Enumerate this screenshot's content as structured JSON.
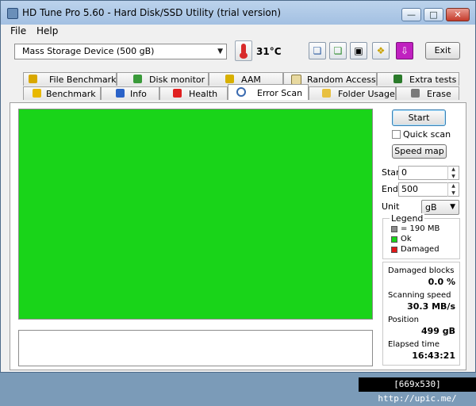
{
  "window": {
    "title": "HD Tune Pro 5.60 - Hard Disk/SSD Utility (trial version)"
  },
  "menu": {
    "file": "File",
    "help": "Help"
  },
  "toolbar": {
    "device": "Mass Storage Device (500 gB)",
    "temperature": "31°C",
    "exit": "Exit"
  },
  "tabs": {
    "top": [
      "File Benchmark",
      "Disk monitor",
      "AAM",
      "Random Access",
      "Extra tests"
    ],
    "bottom": [
      "Benchmark",
      "Info",
      "Health",
      "Error Scan",
      "Folder Usage",
      "Erase"
    ],
    "active": "Error Scan"
  },
  "scan": {
    "start_button": "Start",
    "quick_scan": "Quick scan",
    "quick_scan_checked": false,
    "speed_map_button": "Speed map",
    "start_label": "Start",
    "start_value": "0",
    "end_label": "End",
    "end_value": "500",
    "unit_label": "Unit",
    "unit_value": "gB"
  },
  "legend": {
    "title": "Legend",
    "block": "= 190 MB",
    "ok": "Ok",
    "damaged": "Damaged",
    "colors": {
      "block": "#8a8a8a",
      "ok": "#19d419",
      "damaged": "#e01818"
    }
  },
  "stats": {
    "damaged_label": "Damaged blocks",
    "damaged_value": "0.0 %",
    "speed_label": "Scanning speed",
    "speed_value": "30.3 MB/s",
    "position_label": "Position",
    "position_value": "499 gB",
    "elapsed_label": "Elapsed time",
    "elapsed_value": "16:43:21"
  },
  "watermark": "[669x530] http://upic.me/"
}
